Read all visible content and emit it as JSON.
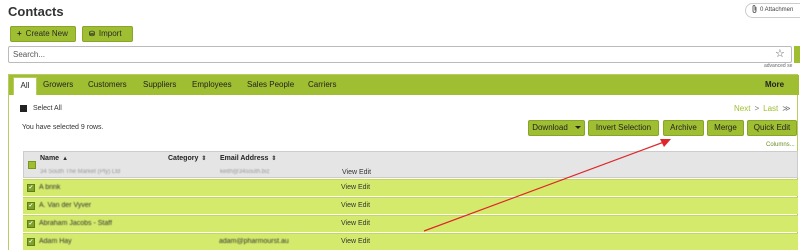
{
  "header": {
    "title": "Contacts",
    "attachments_label": "0 Attachmen"
  },
  "toolbar": {
    "create_label": "Create New",
    "import_label": "Import"
  },
  "search": {
    "placeholder": "Search...",
    "advanced_label": "advanced se"
  },
  "tabs": [
    "All",
    "Growers",
    "Customers",
    "Suppliers",
    "Employees",
    "Sales People",
    "Carriers"
  ],
  "tabs_more": "More",
  "selection": {
    "select_all_label": "Select All",
    "summary": "You have selected 9 rows."
  },
  "pager": {
    "next": "Next",
    "last": "Last"
  },
  "actions": {
    "download": "Download",
    "invert": "Invert Selection",
    "archive": "Archive",
    "merge": "Merge",
    "quick_edit": "Quick Edit"
  },
  "columns_link": "Columns...",
  "table": {
    "headers": {
      "name": "Name",
      "category": "Category",
      "email": "Email Address"
    },
    "first_row": {
      "name": "34 South The Market (Pty) Ltd",
      "email": "keith@34south.biz",
      "action": "View Edit"
    },
    "rows": [
      {
        "name": "A brink",
        "email": "",
        "action": "View Edit"
      },
      {
        "name": "A. Van der Vyver",
        "email": "",
        "action": "View Edit"
      },
      {
        "name": "Abraham Jacobs - Staff",
        "email": "",
        "action": "View Edit"
      },
      {
        "name": "Adam Hay",
        "email": "adam@pharmourst.au",
        "action": "View Edit"
      }
    ]
  },
  "colors": {
    "accent": "#9fbe31",
    "row_selected": "#d4ea6c",
    "annotation_arrow": "#e0262a"
  }
}
